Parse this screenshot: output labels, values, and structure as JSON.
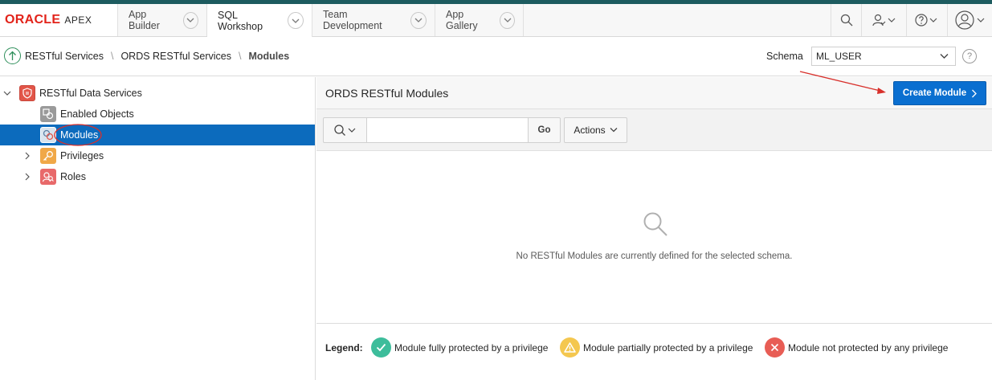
{
  "brand": {
    "oracle": "ORACLE",
    "apex": "APEX"
  },
  "nav": {
    "tabs": [
      {
        "label": "App Builder"
      },
      {
        "label": "SQL Workshop"
      },
      {
        "label": "Team Development"
      },
      {
        "label": "App Gallery"
      }
    ],
    "active_tab": "SQL Workshop",
    "icons": [
      "search-icon",
      "user-icon",
      "help-icon",
      "profile-icon"
    ]
  },
  "breadcrumb": {
    "items": [
      "RESTful Services",
      "ORDS RESTful Services"
    ],
    "current": "Modules",
    "separator": "\\"
  },
  "schema": {
    "label": "Schema",
    "value": "ML_USER",
    "help": "?"
  },
  "tree": {
    "root": "RESTful Data Services",
    "children": [
      {
        "label": "Enabled Objects",
        "icon": "enabled-objects-icon"
      },
      {
        "label": "Modules",
        "icon": "modules-icon",
        "selected": true
      },
      {
        "label": "Privileges",
        "icon": "privileges-icon"
      },
      {
        "label": "Roles",
        "icon": "roles-icon"
      }
    ]
  },
  "region": {
    "title": "ORDS RESTful Modules",
    "create_button": "Create Module"
  },
  "toolbar": {
    "search_value": "",
    "go_label": "Go",
    "actions_label": "Actions"
  },
  "empty_state": {
    "message": "No RESTful Modules are currently defined for the selected schema."
  },
  "legend": {
    "title": "Legend:",
    "items": [
      {
        "label": "Module fully protected by a privilege",
        "color": "#3dbd9b"
      },
      {
        "label": "Module partially protected by a privilege",
        "color": "#f4c74f"
      },
      {
        "label": "Module not protected by any privilege",
        "color": "#e85d55"
      }
    ]
  },
  "colors": {
    "accent": "#0a6fd0",
    "selected_row": "#0c6bbd",
    "brand_red": "#e2231a",
    "header_stripe": "#1d5b5f"
  }
}
